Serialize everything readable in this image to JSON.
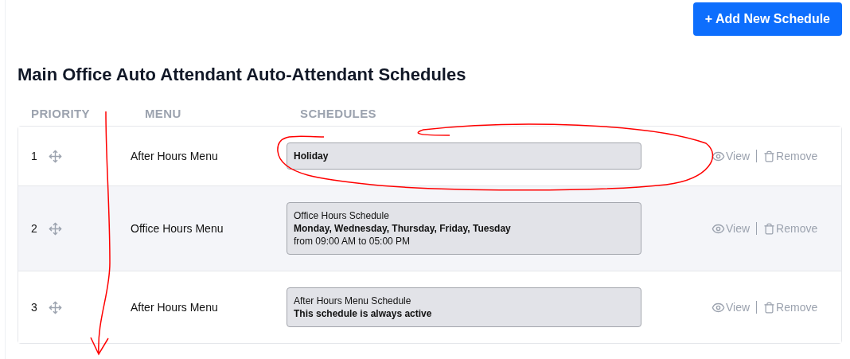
{
  "add_button": {
    "icon": "+",
    "label": "Add New Schedule"
  },
  "title": "Main Office Auto Attendant Auto-Attendant Schedules",
  "columns": [
    "PRIORITY",
    "MENU",
    "SCHEDULES"
  ],
  "rows": [
    {
      "priority": "1",
      "menu": "After Hours Menu",
      "schedule": [
        {
          "text": "Holiday",
          "bold": true
        }
      ],
      "view": "View",
      "remove": "Remove"
    },
    {
      "priority": "2",
      "menu": "Office Hours Menu",
      "schedule": [
        {
          "text": "Office Hours Schedule",
          "bold": false
        },
        {
          "text": "Monday, Wednesday, Thursday, Friday, Tuesday",
          "bold": true
        },
        {
          "text": "from 09:00 AM to 05:00 PM",
          "bold": false
        }
      ],
      "view": "View",
      "remove": "Remove"
    },
    {
      "priority": "3",
      "menu": "After Hours Menu",
      "schedule": [
        {
          "text": "After Hours Menu Schedule",
          "bold": false
        },
        {
          "text": "This schedule is always active",
          "bold": true
        }
      ],
      "view": "View",
      "remove": "Remove"
    }
  ]
}
